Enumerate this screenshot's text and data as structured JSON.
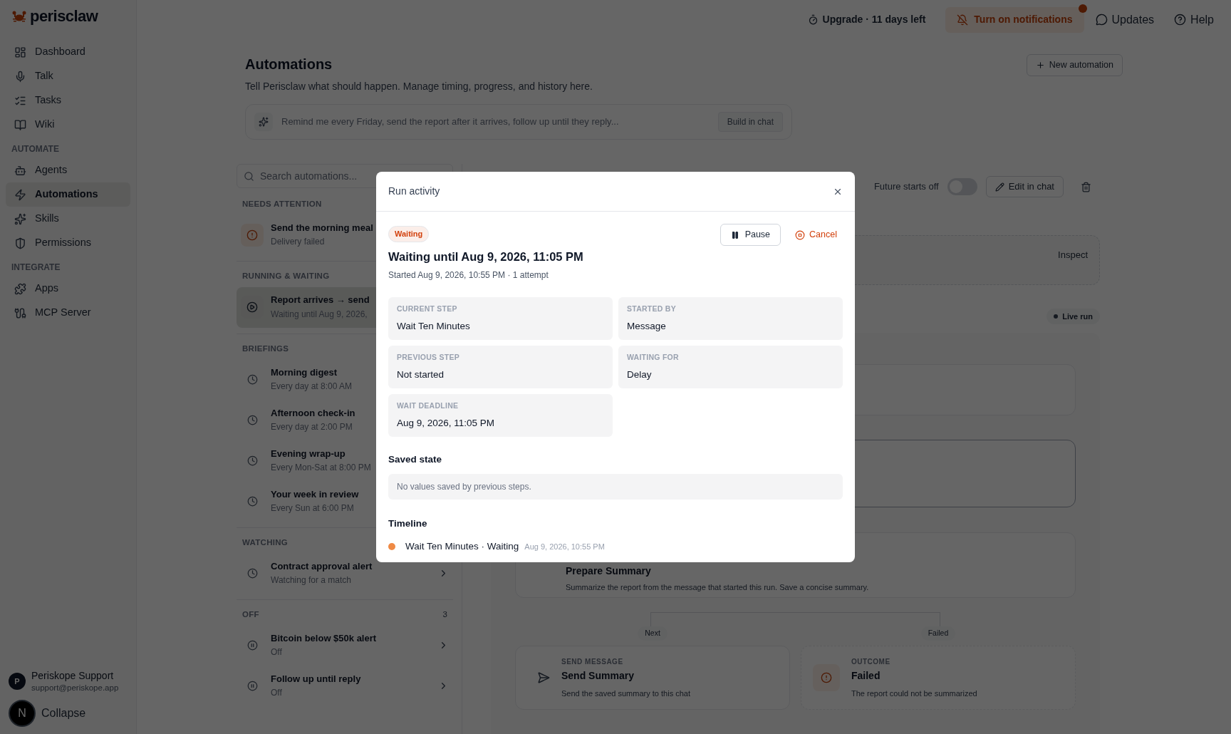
{
  "brand": {
    "name": "perisclaw"
  },
  "sidebar": {
    "sections": [
      {
        "items": [
          {
            "label": "Dashboard",
            "selected": false
          },
          {
            "label": "Talk",
            "selected": false
          },
          {
            "label": "Tasks",
            "selected": false
          },
          {
            "label": "Wiki",
            "selected": false
          }
        ]
      },
      {
        "heading": "AUTOMATE",
        "items": [
          {
            "label": "Agents",
            "selected": false
          },
          {
            "label": "Automations",
            "selected": true
          },
          {
            "label": "Skills",
            "selected": false
          },
          {
            "label": "Permissions",
            "selected": false
          }
        ]
      },
      {
        "heading": "INTEGRATE",
        "items": [
          {
            "label": "Apps",
            "selected": false
          },
          {
            "label": "MCP Server",
            "selected": false
          }
        ]
      }
    ],
    "user": {
      "initial": "P",
      "name": "Periskope Support",
      "email": "support@periskope.app"
    },
    "collapse": "Collapse",
    "dev_badge": "N"
  },
  "topbar": {
    "upgrade": "Upgrade · 11 days left",
    "notifications": {
      "label": "Turn on notifications",
      "badge": true
    },
    "updates": "Updates",
    "help": "Help"
  },
  "header": {
    "title": "Automations",
    "subtitle": "Tell Perisclaw what should happen. Manage timing, progress, and history here.",
    "new_button": "New automation",
    "prompt": {
      "placeholder": "Remind me every Friday, send the report after it arrives, follow up until they reply...",
      "button": "Build in chat"
    }
  },
  "list": {
    "search": {
      "placeholder": "Search automations..."
    },
    "groups": [
      {
        "heading": "NEEDS ATTENTION",
        "items": [
          {
            "title": "Send the morning meal",
            "subtitle": "Delivery failed",
            "kind": "alert",
            "selected": false
          }
        ]
      },
      {
        "heading": "RUNNING & WAITING",
        "items": [
          {
            "title": "Report arrives → send",
            "subtitle": "Waiting until Aug 9, 2026,",
            "kind": "running",
            "selected": true
          }
        ]
      },
      {
        "heading": "BRIEFINGS",
        "items": [
          {
            "title": "Morning digest",
            "subtitle": "Every day at 8:00 AM",
            "kind": "scheduled",
            "selected": false
          },
          {
            "title": "Afternoon check-in",
            "subtitle": "Every day at 2:00 PM",
            "kind": "scheduled",
            "selected": false
          },
          {
            "title": "Evening wrap-up",
            "subtitle": "Every Mon-Sat at 8:00 PM",
            "kind": "scheduled",
            "selected": false
          },
          {
            "title": "Your week in review",
            "subtitle": "Every Sun at 6:00 PM",
            "kind": "scheduled",
            "selected": false
          }
        ]
      },
      {
        "heading": "WATCHING",
        "items": [
          {
            "title": "Contract approval alert",
            "subtitle": "Watching for a match",
            "kind": "scheduled",
            "selected": false
          }
        ]
      },
      {
        "heading": "OFF",
        "count": "3",
        "items": [
          {
            "title": "Bitcoin below $50k alert",
            "subtitle": "Off",
            "kind": "off",
            "selected": false
          },
          {
            "title": "Follow up until reply",
            "subtitle": "Off",
            "kind": "off",
            "selected": false
          }
        ]
      }
    ]
  },
  "detail": {
    "future_starts": {
      "label": "Future starts off",
      "on": false
    },
    "edit_button": "Edit in chat",
    "inspect": "Inspect",
    "live_run": "Live run",
    "prepare": {
      "title": "Prepare Summary",
      "description": "Summarize the report from the message that started this run. Save a concise summary."
    },
    "branches": [
      {
        "label": "Next",
        "step": {
          "type": "SEND MESSAGE",
          "title": "Send Summary",
          "description": "Send the saved summary to this chat",
          "kind": "message"
        }
      },
      {
        "label": "Failed",
        "step": {
          "type": "OUTCOME",
          "title": "Failed",
          "description": "The report could not be summarized",
          "kind": "failed"
        }
      }
    ]
  },
  "modal": {
    "title": "Run activity",
    "status": "Waiting",
    "pause": "Pause",
    "cancel": "Cancel",
    "heading": "Waiting until Aug 9, 2026, 11:05 PM",
    "meta": "Started Aug 9, 2026, 10:55 PM · 1 attempt",
    "fields": [
      {
        "label": "CURRENT STEP",
        "value": "Wait Ten Minutes"
      },
      {
        "label": "STARTED BY",
        "value": "Message"
      },
      {
        "label": "PREVIOUS STEP",
        "value": "Not started"
      },
      {
        "label": "WAITING FOR",
        "value": "Delay"
      },
      {
        "label": "WAIT DEADLINE",
        "value": "Aug 9, 2026, 11:05 PM"
      }
    ],
    "saved_state": {
      "title": "Saved state",
      "empty": "No values saved by previous steps."
    },
    "timeline": {
      "title": "Timeline",
      "events": [
        {
          "label": "Wait Ten Minutes · Waiting",
          "time": "Aug 9, 2026, 10:55 PM",
          "color": "#ef8a45"
        }
      ]
    }
  }
}
